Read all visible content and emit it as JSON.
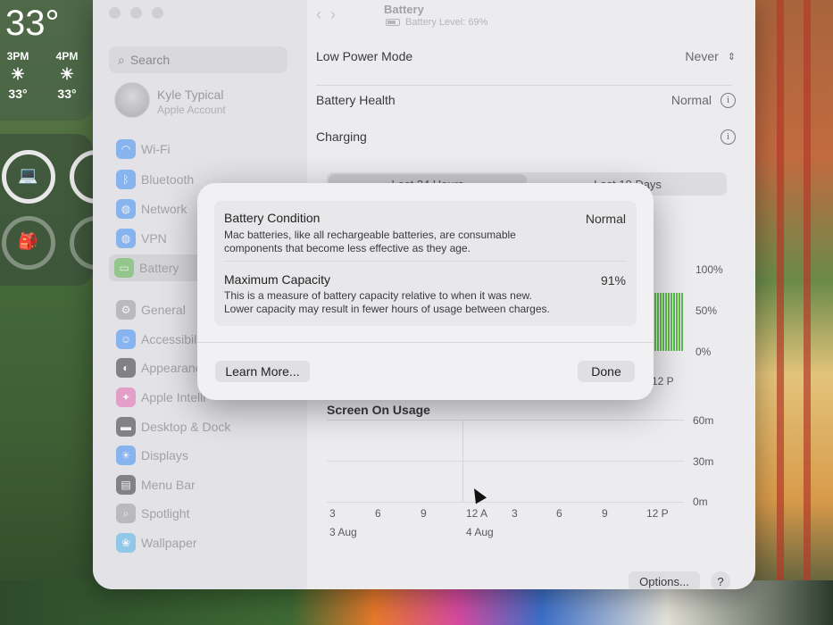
{
  "weather": {
    "temp": "33°",
    "hours": [
      {
        "time": "3PM",
        "temp": "33°"
      },
      {
        "time": "4PM",
        "temp": "33°"
      }
    ]
  },
  "toolbar": {
    "title": "Battery",
    "subtitle": "Battery Level: 69%"
  },
  "sidebar": {
    "search_placeholder": "Search",
    "account_name": "Kyle Typical",
    "account_sub": "Apple Account",
    "items": [
      {
        "label": "Wi-Fi",
        "color": "#3d8df5",
        "icon": "wifi-icon"
      },
      {
        "label": "Bluetooth",
        "color": "#3d8df5",
        "icon": "bluetooth-icon"
      },
      {
        "label": "Network",
        "color": "#3d8df5",
        "icon": "globe-icon"
      },
      {
        "label": "VPN",
        "color": "#3d8df5",
        "icon": "vpn-icon"
      },
      {
        "label": "Battery",
        "color": "#5fba4f",
        "icon": "battery-icon"
      },
      {
        "label": "General",
        "color": "#9a999e",
        "icon": "gear-icon"
      },
      {
        "label": "Accessibili",
        "color": "#3d8df5",
        "icon": "accessibility-icon"
      },
      {
        "label": "Appearanc",
        "color": "#333333",
        "icon": "appearance-icon"
      },
      {
        "label": "Apple Intelli",
        "color": "#e46ab0",
        "icon": "apple-intelligence-icon"
      },
      {
        "label": "Desktop & Dock",
        "color": "#333333",
        "icon": "dock-icon"
      },
      {
        "label": "Displays",
        "color": "#3d8df5",
        "icon": "display-icon"
      },
      {
        "label": "Menu Bar",
        "color": "#333333",
        "icon": "menubar-icon"
      },
      {
        "label": "Spotlight",
        "color": "#9a999e",
        "icon": "spotlight-icon"
      },
      {
        "label": "Wallpaper",
        "color": "#4fb3e8",
        "icon": "wallpaper-icon"
      }
    ]
  },
  "settings": {
    "low_power_label": "Low Power Mode",
    "low_power_value": "Never",
    "health_label": "Battery Health",
    "health_value": "Normal",
    "charging_label": "Charging",
    "seg_left": "Last 24 Hours",
    "seg_right": "Last 10 Days"
  },
  "battery_chart": {
    "y_labels": [
      "100%",
      "50%",
      "0%"
    ],
    "x_last": "12 P"
  },
  "usage": {
    "title": "Screen On Usage",
    "y_labels": [
      "60m",
      "30m",
      "0m"
    ],
    "x_ticks": [
      "3",
      "6",
      "9",
      "12 A",
      "3",
      "6",
      "9",
      "12 P"
    ],
    "dates": [
      "3 Aug",
      "4 Aug"
    ]
  },
  "footer": {
    "options": "Options...",
    "help": "?"
  },
  "dialog": {
    "condition_title": "Battery Condition",
    "condition_value": "Normal",
    "condition_desc": "Mac batteries, like all rechargeable batteries, are consumable components that become less effective as they age.",
    "capacity_title": "Maximum Capacity",
    "capacity_value": "91%",
    "capacity_desc": "This is a measure of battery capacity relative to when it was new. Lower capacity may result in fewer hours of usage between charges.",
    "learn_more": "Learn More...",
    "done": "Done"
  }
}
